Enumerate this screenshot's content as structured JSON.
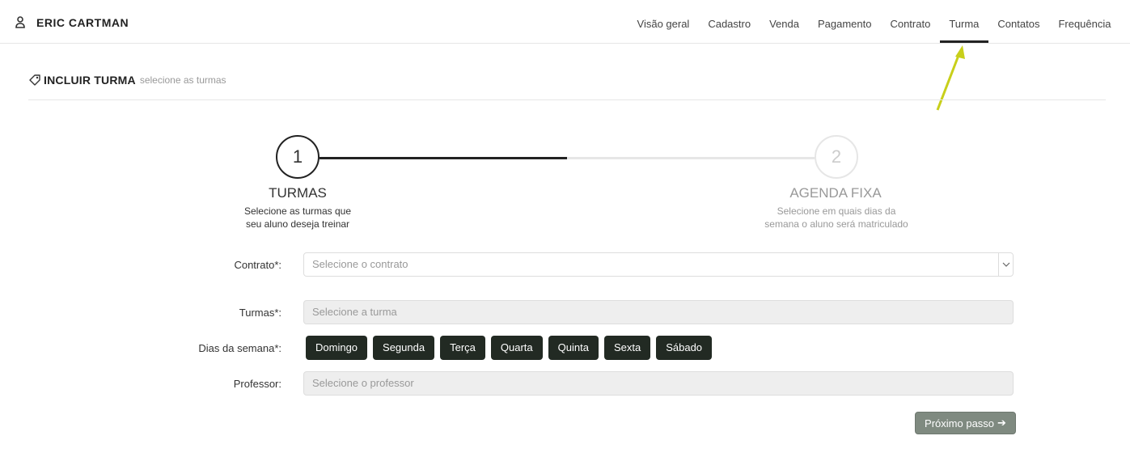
{
  "user": {
    "name": "ERIC CARTMAN",
    "icon": "user-icon"
  },
  "nav": {
    "tabs": [
      {
        "label": "Visão geral"
      },
      {
        "label": "Cadastro"
      },
      {
        "label": "Venda"
      },
      {
        "label": "Pagamento"
      },
      {
        "label": "Contrato"
      },
      {
        "label": "Turma",
        "active": true
      },
      {
        "label": "Contatos"
      },
      {
        "label": "Frequência"
      }
    ]
  },
  "section": {
    "title": "INCLUIR TURMA",
    "subtitle": "selecione as turmas",
    "icon": "tag-icon"
  },
  "steps": [
    {
      "number": "1",
      "title": "TURMAS",
      "desc_line1": "Selecione as turmas que",
      "desc_line2": "seu aluno deseja treinar",
      "status": "active"
    },
    {
      "number": "2",
      "title": "AGENDA FIXA",
      "desc_line1": "Selecione em quais dias da",
      "desc_line2": "semana o aluno será matriculado",
      "status": "pending"
    }
  ],
  "form": {
    "contrato": {
      "label": "Contrato*:",
      "placeholder": "Selecione o contrato"
    },
    "turmas": {
      "label": "Turmas*:",
      "placeholder": "Selecione a turma"
    },
    "dias": {
      "label": "Dias da semana*:",
      "options": [
        "Domingo",
        "Segunda",
        "Terça",
        "Quarta",
        "Quinta",
        "Sexta",
        "Sábado"
      ]
    },
    "professor": {
      "label": "Professor:",
      "placeholder": "Selecione o professor"
    }
  },
  "next_button": {
    "label": "Próximo passo",
    "icon": "arrow-right-icon"
  },
  "colors": {
    "dark": "#222a23",
    "muted_button": "#7f8a80",
    "annotation_arrow": "#c8cf1a"
  }
}
